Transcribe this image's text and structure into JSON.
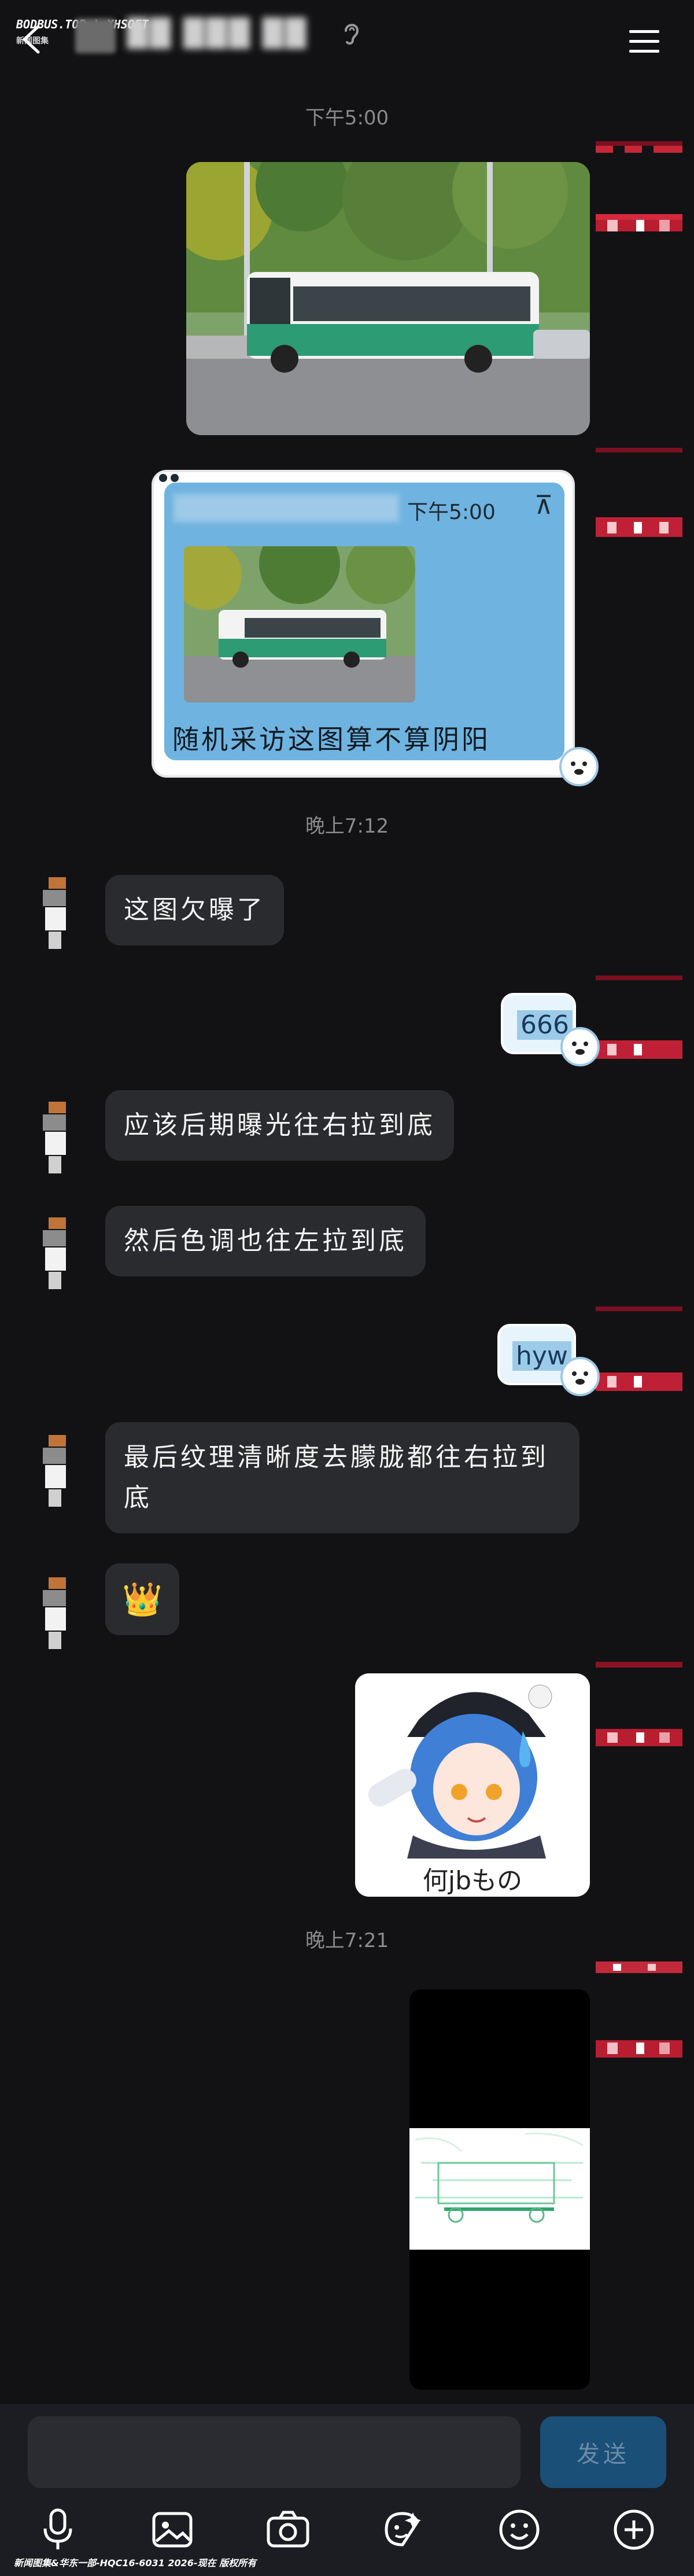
{
  "header": {
    "watermark_top": "BODBUS.TOP | XHSOFT",
    "watermark_sub": "新闻图集",
    "title": "██ ███ ██",
    "menu_icon": "hamburger-menu-icon",
    "ear_icon": "ear-icon"
  },
  "times": {
    "t1": "下午5:00",
    "t2": "晚上7:12",
    "t3": "晚上7:21"
  },
  "quote_card": {
    "time": "下午5:00",
    "caption": "随机采访这图算不算阴阳",
    "collapse_symbol": "⊼"
  },
  "messages": {
    "m1": "这图欠曝了",
    "m2": "666",
    "m3": "应该后期曝光往右拉到底",
    "m4": "然后色调也往左拉到底",
    "m5": "hyw",
    "m6": "最后纹理清晰度去朦胧都往右拉到底",
    "m7": "👑",
    "sticker_caption": "何jbもの"
  },
  "input": {
    "placeholder": "",
    "send_label": "发送"
  },
  "toolbar": {
    "icons": [
      "microphone-icon",
      "image-icon",
      "camera-icon",
      "face-sticker-icon",
      "emoji-icon",
      "plus-icon"
    ]
  },
  "footer": {
    "watermark": "新闻图集&华东一部-HQC16-6031 2026-现在 版权所有"
  },
  "colors": {
    "background": "#121214",
    "bubble_in": "#2a2b2f",
    "send_button": "#1a4f77",
    "quote_blue": "#6fb3e0"
  }
}
